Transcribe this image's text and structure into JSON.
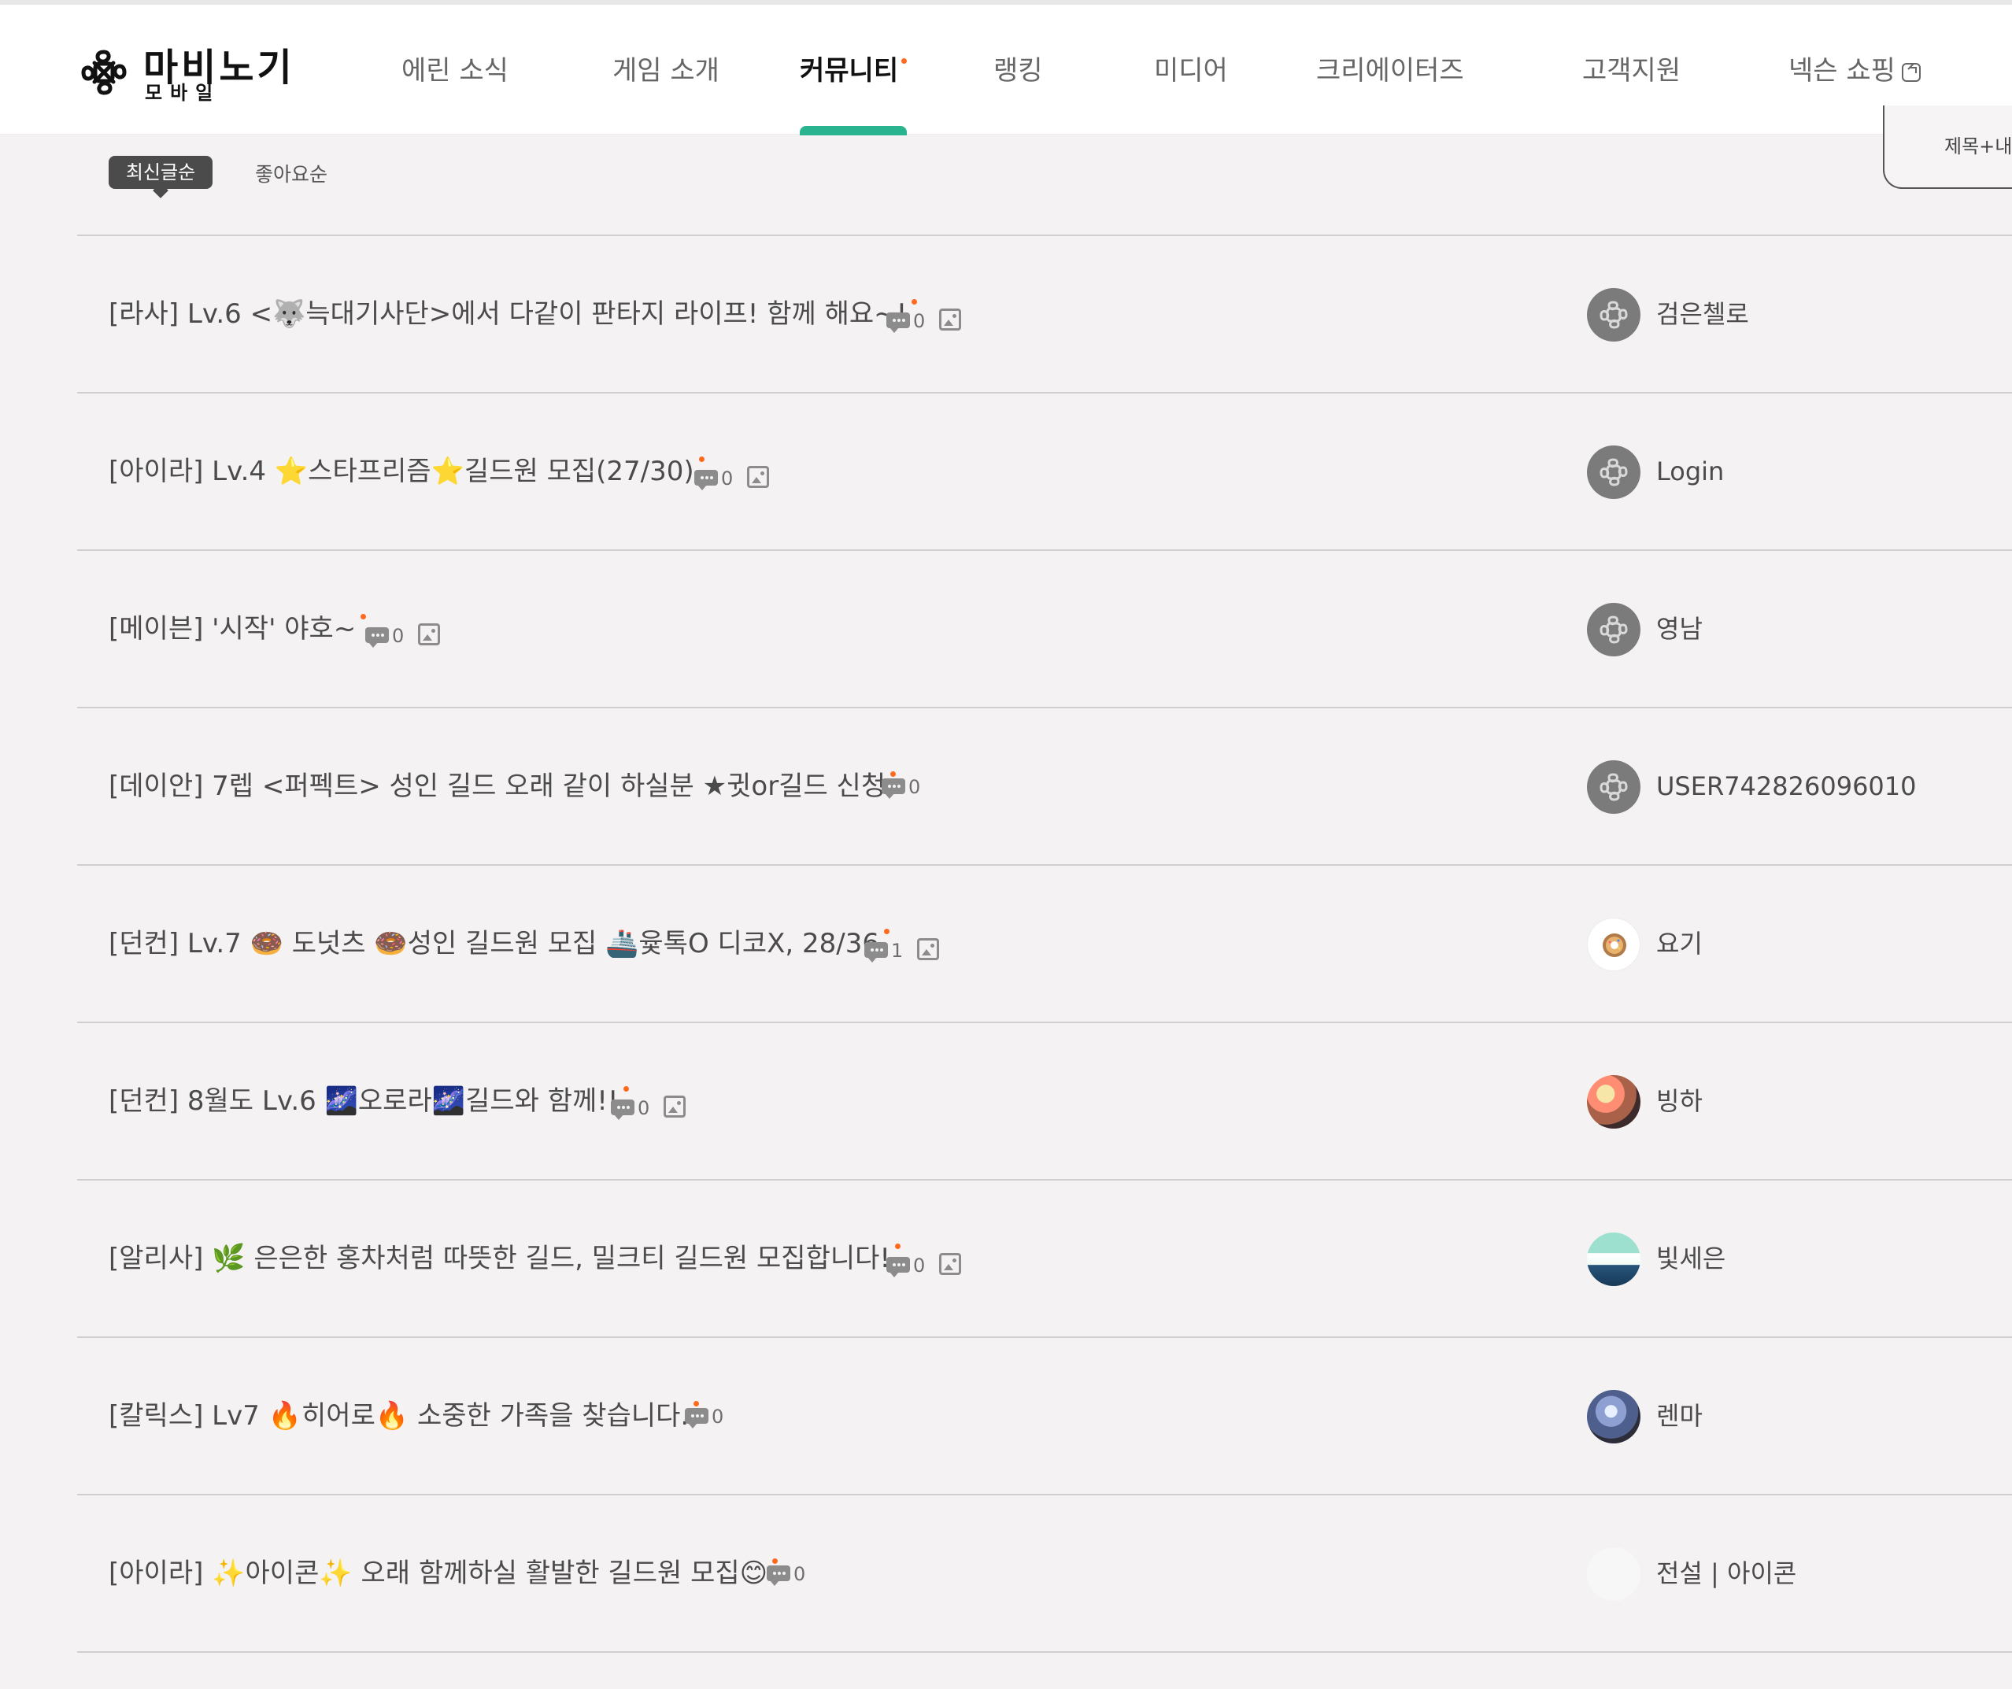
{
  "header": {
    "logo_title": "마비노기",
    "logo_subtitle": "모바일",
    "nav": {
      "news": "에린 소식",
      "game_intro": "게임 소개",
      "community": "커뮤니티",
      "ranking": "랭킹",
      "media": "미디어",
      "creators": "크리에이터즈",
      "support": "고객지원",
      "shopping": "넥슨 쇼핑"
    }
  },
  "filters": {
    "latest": "최신글순",
    "likes": "좋아요순",
    "search_scope": "제목+내"
  },
  "posts": [
    {
      "title": "[라사] Lv.6 <🐺늑대기사단>에서 다같이 판타지 라이프! 함께 해요~!",
      "comments": "0",
      "author": "검은첼로"
    },
    {
      "title": "[아이라] Lv.4 ⭐스타프리즘⭐길드원 모집(27/30)",
      "comments": "0",
      "author": "Login"
    },
    {
      "title": "[메이븐] '시작' 야호~",
      "comments": "0",
      "author": "영남"
    },
    {
      "title": "[데이안] 7렙 <퍼펙트> 성인 길드 오래 같이 하실분 ★귓or길드 신청",
      "comments": "0",
      "author": "USER742826096010"
    },
    {
      "title": "[던컨] Lv.7 🍩 도넛츠 🍩성인 길드원 모집 🚢윷톡O 디코X, 28/36",
      "comments": "1",
      "author": "요기"
    },
    {
      "title": "[던컨] 8월도 Lv.6 🌌오로라🌌길드와 함께!!",
      "comments": "0",
      "author": "빙하"
    },
    {
      "title": "[알리사] 🌿 은은한 홍차처럼 따뜻한 길드, 밀크티 길드원 모집합니다!",
      "comments": "0",
      "author": "빛세은"
    },
    {
      "title": "[칼릭스] Lv7 🔥히어로🔥 소중한 가족을 찾습니다.",
      "comments": "0",
      "author": "렌마"
    },
    {
      "title": "[아이라] ✨아이콘✨ 오래 함께하실 활발한 길드원 모집😊",
      "comments": "0",
      "author": "전설 | 아이콘"
    }
  ]
}
